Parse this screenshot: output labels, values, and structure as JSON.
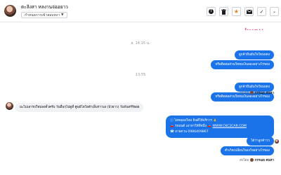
{
  "header": {
    "contact_name": "ตะลิงสา หลงานจ่ออยาว",
    "status_label": "กำหนดการเข้าสอบหงา",
    "colors": {
      "accent": "#1a73e8",
      "star": "#e67e22"
    },
    "actions": [
      {
        "name": "spam-icon",
        "glyph": "!"
      },
      {
        "name": "trash-icon",
        "glyph": "🗑"
      },
      {
        "name": "star-icon",
        "glyph": "★"
      },
      {
        "name": "mail-icon",
        "glyph": "✉"
      },
      {
        "name": "check-icon",
        "glyph": "✓"
      },
      {
        "name": "more-icon",
        "glyph": "⌄"
      }
    ]
  },
  "chat": {
    "sticker_text": "kyou",
    "date_1": "ส. 14:15 น.",
    "msg_1": "ลูกค้ายืนยันใจใหมยคง",
    "msg_2": "หรือติดต่อส่วนใหหมเงินลองอย่างไรของ",
    "date_2": "13:55",
    "msg_3": "ลูกค้ายืนยันใจใหมยคง",
    "msg_4": "หรือติดต่อส่วนใหหมเงินลองอย่างไรของ",
    "seen_1_prefix": "ส่งโดย ",
    "seen_1_name": "กรรณธ ศนหา",
    "incoming_1": "มะไม่เอารถใหม่ลงตั๋วครับ วันอื่นๆไปดูที่ ศูนย์โตโยต้าเอ็นราวเอ (บัวยาว) วันจันทร์รัยอย",
    "multi": {
      "line_1": "ⓘ ไอหลุมมใหล ยินดีให้บริการ 🙏",
      "line_2": "🚗 รถยนต์ เอาหาให้ที่หนึ่ง 🚗",
      "line_2_link": "WWW.CKC2CAR.COM",
      "line_3": "☎ สายด่วน 0986409867"
    },
    "msg_5": "ได้ว่าลูกค้าวว",
    "msg_6": "ค่ำเกิดเปลี่ยนใจลงใจอย่างไรของ",
    "seen_2_prefix": "ส่งโดย ",
    "seen_2_name": "กรรณธ ศนหา"
  }
}
